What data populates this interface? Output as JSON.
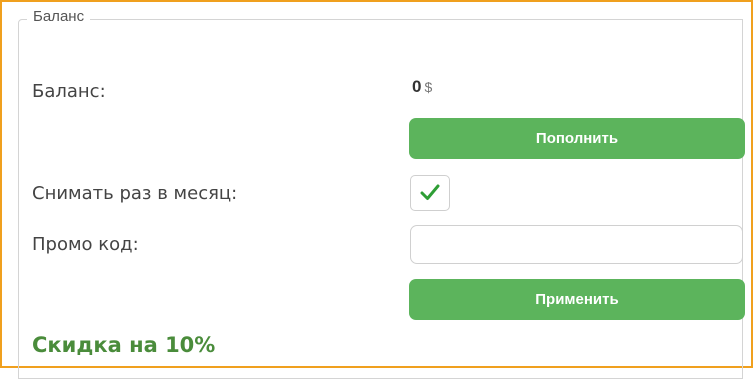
{
  "section": {
    "legend": "Баланс"
  },
  "balance": {
    "label": "Баланс:",
    "amount": "0",
    "currency": "$"
  },
  "topup": {
    "label": "Пополнить"
  },
  "monthly": {
    "label": "Снимать раз в месяц:",
    "checked": true
  },
  "promo": {
    "label": "Промо код:",
    "value": "",
    "placeholder": ""
  },
  "apply": {
    "label": "Применить"
  },
  "discount": {
    "text": "Скидка на 10%"
  },
  "colors": {
    "accent": "#5cb45c",
    "frame": "#f0a01e",
    "discount": "#4a8c3b"
  }
}
